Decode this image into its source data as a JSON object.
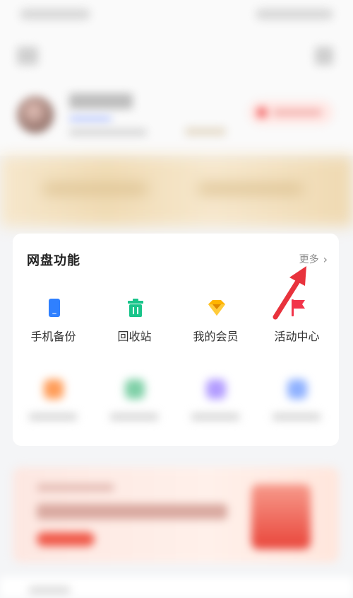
{
  "card": {
    "title": "网盘功能",
    "more_label": "更多"
  },
  "features_row1": [
    {
      "label": "手机备份",
      "icon": "phone-backup-icon",
      "color": "#2f80ff"
    },
    {
      "label": "回收站",
      "icon": "trash-icon",
      "color": "#19c48a"
    },
    {
      "label": "我的会员",
      "icon": "diamond-icon",
      "color": "#ffb400"
    },
    {
      "label": "活动中心",
      "icon": "flag-icon",
      "color": "#f2344a"
    }
  ],
  "features_row2_icons": [
    "orange-flame-icon",
    "green-folder-icon",
    "purple-download-icon",
    "blue-bow-icon"
  ],
  "colors": {
    "accent_red": "#e8323c",
    "background": "#f4f5f7"
  }
}
